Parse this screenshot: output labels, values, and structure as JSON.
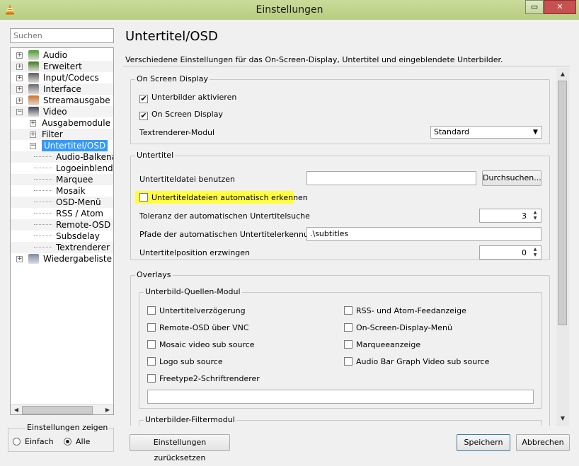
{
  "window": {
    "title": "Einstellungen"
  },
  "left": {
    "search_placeholder": "Suchen",
    "tree": [
      {
        "label": "Audio",
        "icon": "music-icon",
        "expander": "+"
      },
      {
        "label": "Erweitert",
        "icon": "chip-icon",
        "expander": "+"
      },
      {
        "label": "Input/Codecs",
        "icon": "codec-icon",
        "expander": "+"
      },
      {
        "label": "Interface",
        "icon": "interface-icon",
        "expander": "+"
      },
      {
        "label": "Streamausgabe",
        "icon": "stream-icon",
        "expander": "+"
      },
      {
        "label": "Video",
        "icon": "film-icon",
        "expander": "−"
      },
      {
        "label": "Ausgabemodule",
        "expander": "+"
      },
      {
        "label": "Filter",
        "expander": "+"
      },
      {
        "label": "Untertitel/OSD",
        "expander": "−",
        "selected": true
      },
      {
        "label": "Audio-Balkenar"
      },
      {
        "label": "Logoeinblendu"
      },
      {
        "label": "Marquee"
      },
      {
        "label": "Mosaik"
      },
      {
        "label": "OSD-Menü"
      },
      {
        "label": "RSS / Atom"
      },
      {
        "label": "Remote-OSD"
      },
      {
        "label": "Subsdelay"
      },
      {
        "label": "Textrenderer"
      },
      {
        "label": "Wiedergabeliste",
        "icon": "playlist-icon",
        "expander": "+"
      }
    ],
    "show_settings": {
      "legend": "Einstellungen zeigen",
      "simple": "Einfach",
      "all": "Alle",
      "selected": "Alle"
    }
  },
  "main": {
    "title": "Untertitel/OSD",
    "description": "Verschiedene Einstellungen für das On-Screen-Display, Untertitel und eingeblendete Unterbilder.",
    "osd": {
      "legend": "On Screen Display",
      "subpictures": "Unterbilder aktivieren",
      "subpictures_checked": true,
      "osd": "On Screen Display",
      "osd_checked": true,
      "renderer_label": "Textrenderer-Modul",
      "renderer_value": "Standard"
    },
    "subtitles": {
      "legend": "Untertitel",
      "file_label": "Untertiteldatei benutzen",
      "file_value": "",
      "browse": "Durchsuchen...",
      "autodetect": "Untertiteldateien automatisch erkennen",
      "autodetect_checked": false,
      "tolerance_label": "Toleranz der automatischen Untertitelsuche",
      "tolerance_value": "3",
      "paths_label": "Pfade der automatischen Untertitelerkennung",
      "paths_value": ".\\subtitles",
      "position_label": "Untertitelposition erzwingen",
      "position_value": "0"
    },
    "overlays": {
      "legend": "Overlays",
      "sources_legend": "Unterbild-Quellen-Modul",
      "sources": [
        "Untertitelverzögerung",
        "RSS- und Atom-Feedanzeige",
        "Remote-OSD über VNC",
        "On-Screen-Display-Menü",
        "Mosaic video sub source",
        "Marqueeanzeige",
        "Logo sub source",
        "Audio Bar Graph Video sub source",
        "Freetype2-Schriftrenderer"
      ],
      "sources_text": "",
      "filter_legend": "Unterbilder-Filtermodul"
    }
  },
  "footer": {
    "reset": "Einstellungen zurücksetzen",
    "save": "Speichern",
    "cancel": "Abbrechen"
  },
  "colors": {
    "highlight": "#ffff40",
    "selection": "#3399ff",
    "titlebar": "#b7cd80"
  }
}
